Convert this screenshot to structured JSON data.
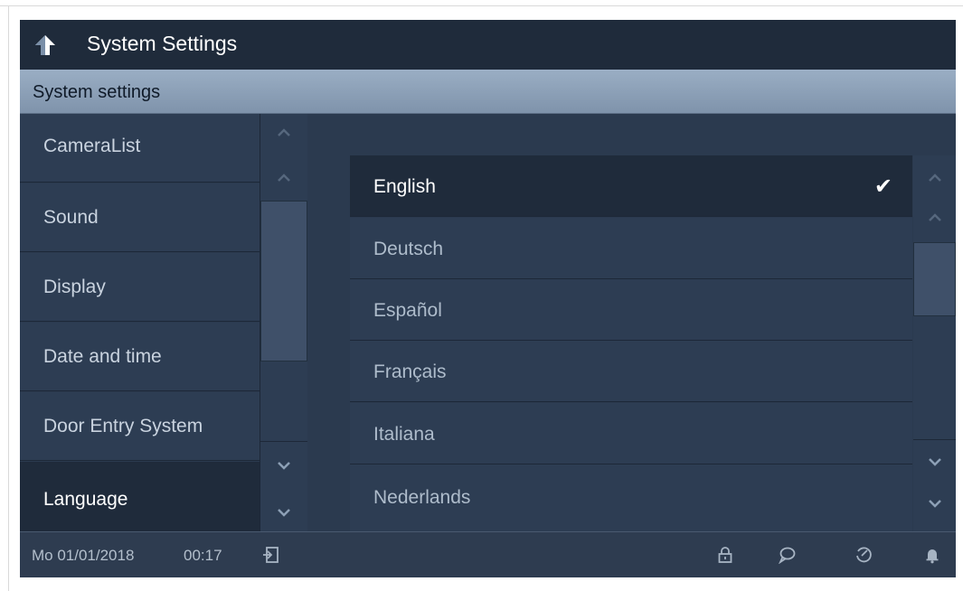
{
  "header": {
    "title": "System Settings",
    "back_icon": "back-arrow-icon"
  },
  "subheader": {
    "title": "System settings"
  },
  "menu": {
    "items": [
      {
        "label": "CameraList",
        "active": false
      },
      {
        "label": "Sound",
        "active": false
      },
      {
        "label": "Display",
        "active": false
      },
      {
        "label": "Date and time",
        "active": false
      },
      {
        "label": "Door Entry System",
        "active": false
      },
      {
        "label": "Language",
        "active": true
      }
    ]
  },
  "languages": {
    "items": [
      {
        "label": "English",
        "selected": true
      },
      {
        "label": "Deutsch",
        "selected": false
      },
      {
        "label": "Español",
        "selected": false
      },
      {
        "label": "Français",
        "selected": false
      },
      {
        "label": "Italiana",
        "selected": false
      },
      {
        "label": "Nederlands",
        "selected": false
      }
    ],
    "check_mark": "✔"
  },
  "status": {
    "date": "Mo 01/01/2018",
    "time": "00:17",
    "icons": [
      "logout-icon",
      "lock-icon",
      "message-icon",
      "history-icon",
      "bell-icon"
    ]
  },
  "colors": {
    "accent_dark": "#1f2b3b",
    "panel": "#2d3d53",
    "subheader": "#8ea3b9"
  }
}
